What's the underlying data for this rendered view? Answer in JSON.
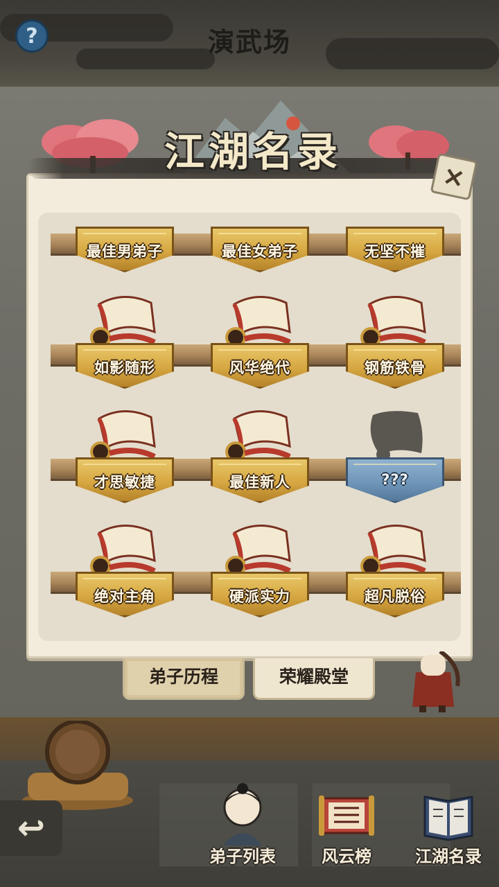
{
  "header": {
    "title": "演武场",
    "help_label": "?"
  },
  "dialog": {
    "title": "江湖名录",
    "close_label": "×"
  },
  "awards": [
    {
      "label": "最佳男弟子",
      "locked": false
    },
    {
      "label": "最佳女弟子",
      "locked": false
    },
    {
      "label": "无坚不摧",
      "locked": false
    },
    {
      "label": "如影随形",
      "locked": false
    },
    {
      "label": "风华绝代",
      "locked": false
    },
    {
      "label": "钢筋铁骨",
      "locked": false
    },
    {
      "label": "才思敏捷",
      "locked": false
    },
    {
      "label": "最佳新人",
      "locked": false
    },
    {
      "label": "???",
      "locked": true
    },
    {
      "label": "绝对主角",
      "locked": false
    },
    {
      "label": "硬派实力",
      "locked": false
    },
    {
      "label": "超凡脱俗",
      "locked": false
    }
  ],
  "tabs": [
    {
      "label": "弟子历程",
      "active": false
    },
    {
      "label": "荣耀殿堂",
      "active": true
    }
  ],
  "bottom_nav": {
    "back_icon": "back-arrow-icon",
    "items": [
      {
        "label": "弟子列表",
        "icon": "disciple-avatar-icon"
      },
      {
        "label": "风云榜",
        "icon": "ranking-scroll-icon"
      },
      {
        "label": "江湖名录",
        "icon": "record-book-icon"
      }
    ]
  },
  "colors": {
    "panel": "#f3ecdc",
    "plaque_gold": "#d6a741",
    "plaque_locked": "#6d93b6",
    "accent_red": "#c0392b"
  }
}
